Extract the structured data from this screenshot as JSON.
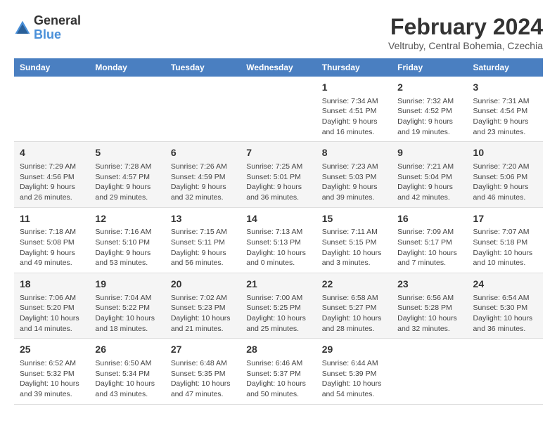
{
  "header": {
    "logo_line1": "General",
    "logo_line2": "Blue",
    "main_title": "February 2024",
    "subtitle": "Veltruby, Central Bohemia, Czechia"
  },
  "weekdays": [
    "Sunday",
    "Monday",
    "Tuesday",
    "Wednesday",
    "Thursday",
    "Friday",
    "Saturday"
  ],
  "weeks": [
    [
      {
        "day": "",
        "info": ""
      },
      {
        "day": "",
        "info": ""
      },
      {
        "day": "",
        "info": ""
      },
      {
        "day": "",
        "info": ""
      },
      {
        "day": "1",
        "info": "Sunrise: 7:34 AM\nSunset: 4:51 PM\nDaylight: 9 hours\nand 16 minutes."
      },
      {
        "day": "2",
        "info": "Sunrise: 7:32 AM\nSunset: 4:52 PM\nDaylight: 9 hours\nand 19 minutes."
      },
      {
        "day": "3",
        "info": "Sunrise: 7:31 AM\nSunset: 4:54 PM\nDaylight: 9 hours\nand 23 minutes."
      }
    ],
    [
      {
        "day": "4",
        "info": "Sunrise: 7:29 AM\nSunset: 4:56 PM\nDaylight: 9 hours\nand 26 minutes."
      },
      {
        "day": "5",
        "info": "Sunrise: 7:28 AM\nSunset: 4:57 PM\nDaylight: 9 hours\nand 29 minutes."
      },
      {
        "day": "6",
        "info": "Sunrise: 7:26 AM\nSunset: 4:59 PM\nDaylight: 9 hours\nand 32 minutes."
      },
      {
        "day": "7",
        "info": "Sunrise: 7:25 AM\nSunset: 5:01 PM\nDaylight: 9 hours\nand 36 minutes."
      },
      {
        "day": "8",
        "info": "Sunrise: 7:23 AM\nSunset: 5:03 PM\nDaylight: 9 hours\nand 39 minutes."
      },
      {
        "day": "9",
        "info": "Sunrise: 7:21 AM\nSunset: 5:04 PM\nDaylight: 9 hours\nand 42 minutes."
      },
      {
        "day": "10",
        "info": "Sunrise: 7:20 AM\nSunset: 5:06 PM\nDaylight: 9 hours\nand 46 minutes."
      }
    ],
    [
      {
        "day": "11",
        "info": "Sunrise: 7:18 AM\nSunset: 5:08 PM\nDaylight: 9 hours\nand 49 minutes."
      },
      {
        "day": "12",
        "info": "Sunrise: 7:16 AM\nSunset: 5:10 PM\nDaylight: 9 hours\nand 53 minutes."
      },
      {
        "day": "13",
        "info": "Sunrise: 7:15 AM\nSunset: 5:11 PM\nDaylight: 9 hours\nand 56 minutes."
      },
      {
        "day": "14",
        "info": "Sunrise: 7:13 AM\nSunset: 5:13 PM\nDaylight: 10 hours\nand 0 minutes."
      },
      {
        "day": "15",
        "info": "Sunrise: 7:11 AM\nSunset: 5:15 PM\nDaylight: 10 hours\nand 3 minutes."
      },
      {
        "day": "16",
        "info": "Sunrise: 7:09 AM\nSunset: 5:17 PM\nDaylight: 10 hours\nand 7 minutes."
      },
      {
        "day": "17",
        "info": "Sunrise: 7:07 AM\nSunset: 5:18 PM\nDaylight: 10 hours\nand 10 minutes."
      }
    ],
    [
      {
        "day": "18",
        "info": "Sunrise: 7:06 AM\nSunset: 5:20 PM\nDaylight: 10 hours\nand 14 minutes."
      },
      {
        "day": "19",
        "info": "Sunrise: 7:04 AM\nSunset: 5:22 PM\nDaylight: 10 hours\nand 18 minutes."
      },
      {
        "day": "20",
        "info": "Sunrise: 7:02 AM\nSunset: 5:23 PM\nDaylight: 10 hours\nand 21 minutes."
      },
      {
        "day": "21",
        "info": "Sunrise: 7:00 AM\nSunset: 5:25 PM\nDaylight: 10 hours\nand 25 minutes."
      },
      {
        "day": "22",
        "info": "Sunrise: 6:58 AM\nSunset: 5:27 PM\nDaylight: 10 hours\nand 28 minutes."
      },
      {
        "day": "23",
        "info": "Sunrise: 6:56 AM\nSunset: 5:28 PM\nDaylight: 10 hours\nand 32 minutes."
      },
      {
        "day": "24",
        "info": "Sunrise: 6:54 AM\nSunset: 5:30 PM\nDaylight: 10 hours\nand 36 minutes."
      }
    ],
    [
      {
        "day": "25",
        "info": "Sunrise: 6:52 AM\nSunset: 5:32 PM\nDaylight: 10 hours\nand 39 minutes."
      },
      {
        "day": "26",
        "info": "Sunrise: 6:50 AM\nSunset: 5:34 PM\nDaylight: 10 hours\nand 43 minutes."
      },
      {
        "day": "27",
        "info": "Sunrise: 6:48 AM\nSunset: 5:35 PM\nDaylight: 10 hours\nand 47 minutes."
      },
      {
        "day": "28",
        "info": "Sunrise: 6:46 AM\nSunset: 5:37 PM\nDaylight: 10 hours\nand 50 minutes."
      },
      {
        "day": "29",
        "info": "Sunrise: 6:44 AM\nSunset: 5:39 PM\nDaylight: 10 hours\nand 54 minutes."
      },
      {
        "day": "",
        "info": ""
      },
      {
        "day": "",
        "info": ""
      }
    ]
  ]
}
